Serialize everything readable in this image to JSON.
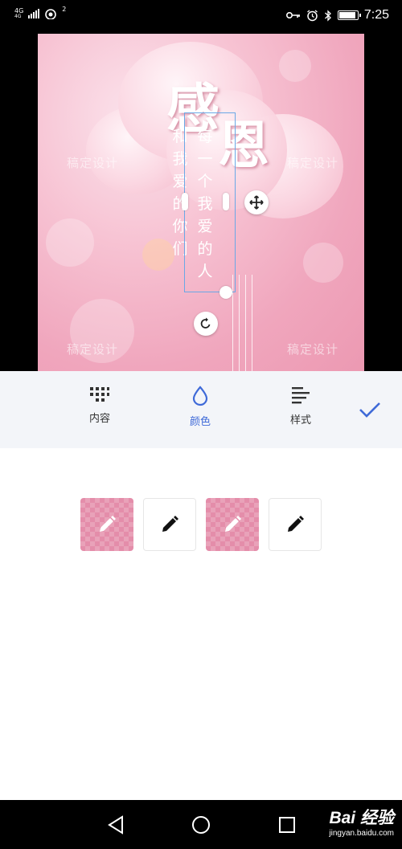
{
  "status_bar": {
    "network_type": "4G",
    "network_sub": "4G",
    "wifi_sub": "2",
    "time": "7:25",
    "icons": [
      "signal-icon",
      "wifi-icon",
      "key-icon",
      "alarm-icon",
      "bluetooth-icon",
      "battery-icon"
    ],
    "battery_level": 0.85
  },
  "poster": {
    "title_char_1": "感",
    "title_char_2": "恩",
    "left_column_text": [
      "和",
      "我",
      "爱",
      "的",
      "你",
      "们"
    ],
    "selected_column_text": [
      "每",
      "一",
      "个",
      "我",
      "爱",
      "的",
      "人"
    ],
    "watermarks": [
      "稿定设计",
      "稿定设计",
      "稿定设计",
      "稿定设计"
    ],
    "background_color": "#f0a6bd"
  },
  "toolbar": {
    "tabs": [
      {
        "label": "内容",
        "icon": "grid-icon",
        "active": false
      },
      {
        "label": "颜色",
        "icon": "drop-icon",
        "active": true
      },
      {
        "label": "样式",
        "icon": "align-left-icon",
        "active": false
      }
    ],
    "confirm_icon": "check-icon",
    "active_color": "#3f6ad8"
  },
  "color_panel": {
    "swatches": [
      {
        "style": "checker",
        "pen_color": "#ffffff",
        "icon": "pencil-icon"
      },
      {
        "style": "plain",
        "pen_color": "#111111",
        "icon": "pencil-icon"
      },
      {
        "style": "checker",
        "pen_color": "#ffffff",
        "icon": "pencil-icon"
      },
      {
        "style": "plain",
        "pen_color": "#111111",
        "icon": "pencil-icon"
      }
    ]
  },
  "nav_bar": {
    "buttons": [
      "back-icon",
      "home-icon",
      "recents-icon"
    ],
    "watermark_logo": "Bai 经验",
    "watermark_url": "jingyan.baidu.com"
  }
}
